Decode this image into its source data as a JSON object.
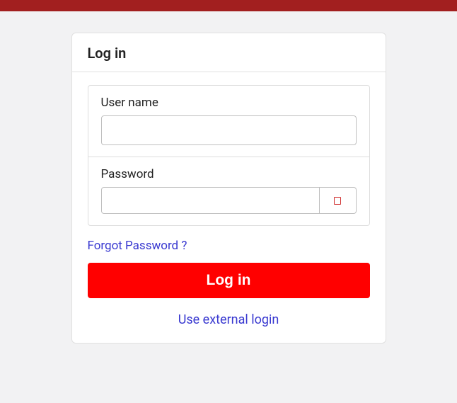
{
  "header": {
    "bar_color": "#a21f1f"
  },
  "card": {
    "title": "Log in"
  },
  "form": {
    "username": {
      "label": "User name",
      "value": "",
      "placeholder": ""
    },
    "password": {
      "label": "Password",
      "value": "",
      "placeholder": ""
    }
  },
  "links": {
    "forgot": "Forgot Password ?",
    "external": "Use external login"
  },
  "buttons": {
    "login": "Log in"
  },
  "colors": {
    "accent": "#ff0000",
    "link": "#3838d0"
  }
}
